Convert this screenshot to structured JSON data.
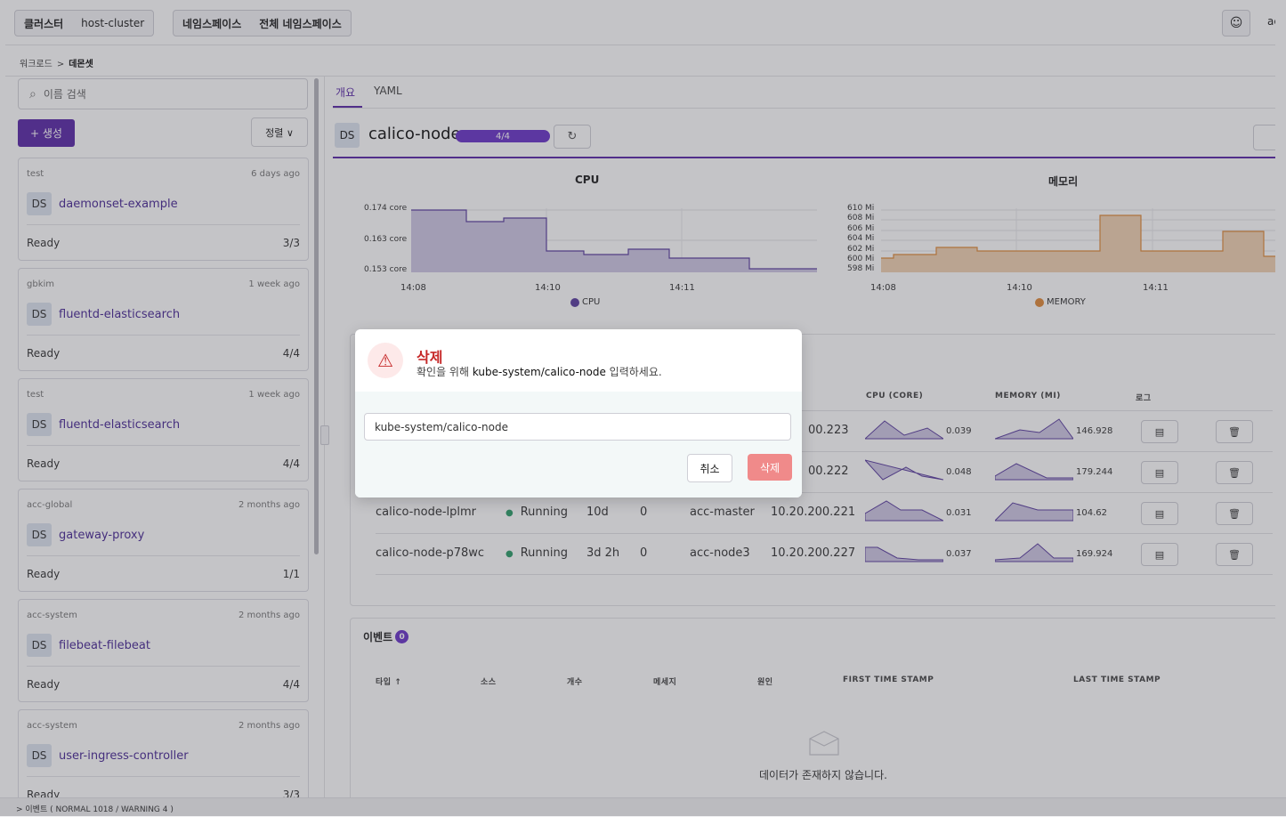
{
  "topbar": {
    "cluster_label": "클러스터",
    "cluster_value": "host-cluster",
    "namespace_label": "네임스페이스",
    "namespace_value": "전체 네임스페이스",
    "user_partial": "ac"
  },
  "breadcrumb": {
    "parent": "워크로드",
    "separator": ">",
    "current": "데몬셋"
  },
  "sidebar": {
    "search_placeholder": "이름 검색",
    "create_label": "+ 생성",
    "sort_label": "정렬 ∨",
    "items": [
      {
        "namespace": "test",
        "age": "6 days ago",
        "kind": "DS",
        "name": "daemonset-example",
        "status": "Ready",
        "count": "3/3"
      },
      {
        "namespace": "gbkim",
        "age": "1 week ago",
        "kind": "DS",
        "name": "fluentd-elasticsearch",
        "status": "Ready",
        "count": "4/4"
      },
      {
        "namespace": "test",
        "age": "1 week ago",
        "kind": "DS",
        "name": "fluentd-elasticsearch",
        "status": "Ready",
        "count": "4/4"
      },
      {
        "namespace": "acc-global",
        "age": "2 months ago",
        "kind": "DS",
        "name": "gateway-proxy",
        "status": "Ready",
        "count": "1/1"
      },
      {
        "namespace": "acc-system",
        "age": "2 months ago",
        "kind": "DS",
        "name": "filebeat-filebeat",
        "status": "Ready",
        "count": "4/4"
      },
      {
        "namespace": "acc-system",
        "age": "2 months ago",
        "kind": "DS",
        "name": "user-ingress-controller",
        "status": "Ready",
        "count": "3/3"
      }
    ]
  },
  "tabs": [
    {
      "label": "개요"
    },
    {
      "label": "YAML"
    }
  ],
  "detail": {
    "kind": "DS",
    "title": "calico-node",
    "progress_text": "4/4",
    "progress": 1.0
  },
  "charts": {
    "cpu": {
      "title": "CPU",
      "legend": "CPU",
      "y_ticks": [
        "0.174 core",
        "0.163 core",
        "0.153 core"
      ],
      "x_ticks": [
        "14:08",
        "14:10",
        "14:11"
      ],
      "color": "#5b3ea0",
      "fill": "#cfc8e4"
    },
    "memory": {
      "title": "메모리",
      "legend": "MEMORY",
      "y_ticks": [
        "610 Mi",
        "608 Mi",
        "606 Mi",
        "604 Mi",
        "602 Mi",
        "600 Mi",
        "598 Mi"
      ],
      "x_ticks": [
        "14:08",
        "14:10",
        "14:11"
      ],
      "color": "#e08a3a",
      "fill": "#f1d2b2"
    }
  },
  "pods": {
    "headers": {
      "cpu": "CPU (CORE)",
      "memory": "MEMORY (MI)",
      "log": "로그"
    },
    "rows": [
      {
        "name": "",
        "status": "",
        "age": "",
        "restarts": "",
        "node": "",
        "ip": "00.223",
        "cpu": "0.039",
        "memory": "146.928"
      },
      {
        "name": "",
        "status": "",
        "age": "",
        "restarts": "",
        "node": "",
        "ip": "00.222",
        "cpu": "0.048",
        "memory": "179.244"
      },
      {
        "name": "calico-node-lplmr",
        "status": "Running",
        "age": "10d",
        "restarts": "0",
        "node": "acc-master",
        "ip": "10.20.200.221",
        "cpu": "0.031",
        "memory": "104.62"
      },
      {
        "name": "calico-node-p78wc",
        "status": "Running",
        "age": "3d 2h",
        "restarts": "0",
        "node": "acc-node3",
        "ip": "10.20.200.227",
        "cpu": "0.037",
        "memory": "169.924"
      }
    ],
    "status_color": "#2e9e6b"
  },
  "events": {
    "title": "이벤트",
    "count": "0",
    "headers": [
      "타입 ↑",
      "소스",
      "개수",
      "메세지",
      "원인",
      "FIRST TIME STAMP",
      "LAST TIME STAMP"
    ],
    "empty_text": "데이터가 존재하지 않습니다."
  },
  "statusbar": {
    "text": "> 이벤트 ( NORMAL 1018 / WARNING 4 )"
  },
  "modal": {
    "title": "삭제",
    "sub_prefix": "확인을 위해 ",
    "sub_target": "kube-system/calico-node",
    "sub_suffix": " 입력하세요.",
    "input_value": "kube-system/calico-node",
    "cancel_label": "취소",
    "delete_label": "삭제",
    "accent": "#c62828"
  }
}
